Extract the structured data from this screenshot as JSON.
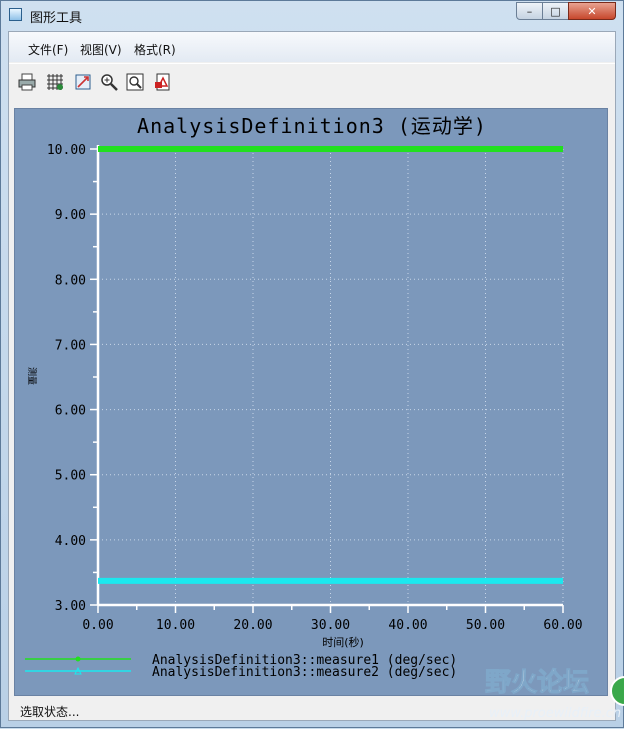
{
  "window": {
    "title": "图形工具",
    "controls": {
      "minimize": "–",
      "maximize": "□",
      "close": "✕"
    }
  },
  "menu": {
    "items": [
      {
        "label": "文件(F)",
        "name": "menu-file"
      },
      {
        "label": "视图(V)",
        "name": "menu-view"
      },
      {
        "label": "格式(R)",
        "name": "menu-format"
      }
    ]
  },
  "toolbar": {
    "icons": [
      "print-icon",
      "grid-icon",
      "export-icon",
      "zoom-in-icon",
      "zoom-fit-icon",
      "pdf-icon"
    ]
  },
  "chart_data": {
    "type": "line",
    "title": "AnalysisDefinition3 (运动学)",
    "xlabel": "时间(秒)",
    "ylabel": "测量",
    "xlim": [
      0,
      60
    ],
    "ylim": [
      3,
      10
    ],
    "xticks": [
      "0.00",
      "10.00",
      "20.00",
      "30.00",
      "40.00",
      "50.00",
      "60.00"
    ],
    "yticks": [
      "3.00",
      "4.00",
      "5.00",
      "6.00",
      "7.00",
      "8.00",
      "9.00",
      "10.00"
    ],
    "grid": true,
    "legend_position": "bottom-left",
    "series": [
      {
        "name": "AnalysisDefinition3::measure1 (deg/sec)",
        "color": "#22e01f",
        "x": [
          0,
          60
        ],
        "y": [
          10,
          10
        ]
      },
      {
        "name": "AnalysisDefinition3::measure2 (deg/sec)",
        "color": "#1be8ef",
        "x": [
          0,
          60
        ],
        "y": [
          3.37,
          3.37
        ]
      }
    ]
  },
  "status": {
    "text": "选取状态..."
  },
  "watermark": {
    "text": "野火论坛",
    "url": "www.proewildfire.cn"
  }
}
